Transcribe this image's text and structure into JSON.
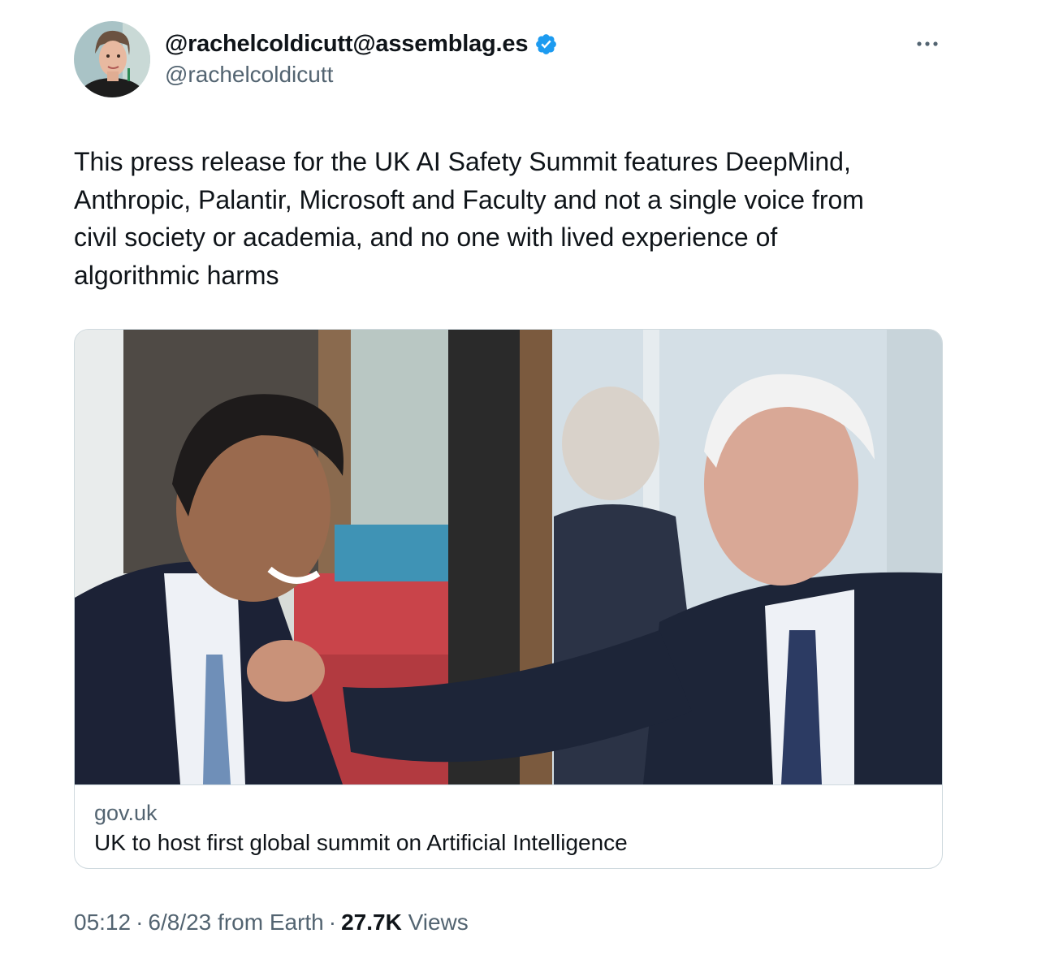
{
  "author": {
    "display_name": "@rachelcoldicutt@assemblag.es",
    "handle": "@rachelcoldicutt",
    "verified_color": "#1d9bf0"
  },
  "tweet": {
    "text": "This press release for the UK AI Safety Summit features DeepMind,\nAnthropic, Palantir, Microsoft and Faculty and not a single voice from\ncivil society or academia, and no one with lived experience of\nalgorithmic harms"
  },
  "link_card": {
    "domain": "gov.uk",
    "title": "UK to host first global summit on Artificial Intelligence"
  },
  "meta": {
    "time": "05:12",
    "date": "6/8/23",
    "source": "from Earth",
    "separator": "·",
    "views_count": "27.7K",
    "views_label": "Views"
  },
  "icons": {
    "more": "more-horizontal-icon",
    "verified": "verified-badge-icon"
  }
}
